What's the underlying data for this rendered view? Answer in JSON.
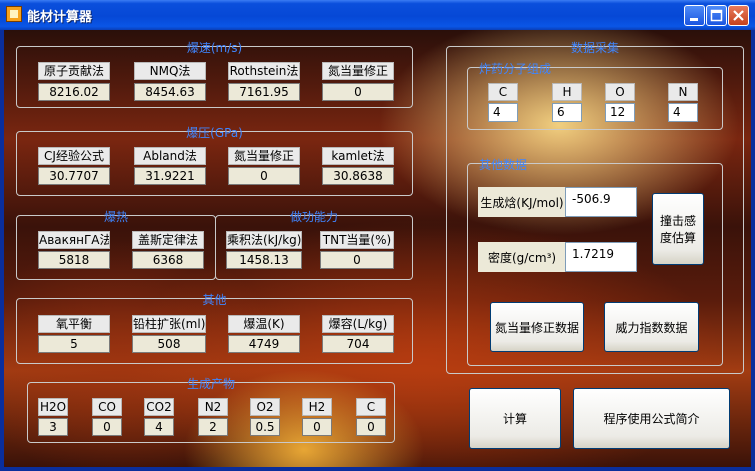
{
  "window": {
    "title": "能材计算器"
  },
  "detonation_velocity": {
    "title": "爆速(m/s)",
    "items": [
      {
        "label": "原子贡献法",
        "value": "8216.02"
      },
      {
        "label": "NMQ法",
        "value": "8454.63"
      },
      {
        "label": "Rothstein法",
        "value": "7161.95"
      },
      {
        "label": "氮当量修正",
        "value": "0"
      }
    ]
  },
  "detonation_pressure": {
    "title": "爆压(GPa)",
    "items": [
      {
        "label": "CJ经验公式",
        "value": "30.7707"
      },
      {
        "label": "Abland法",
        "value": "31.9221"
      },
      {
        "label": "氮当量修正",
        "value": "0"
      },
      {
        "label": "kamlet法",
        "value": "30.8638"
      }
    ]
  },
  "explosion_heat": {
    "title": "爆热",
    "items": [
      {
        "label": "AвакянГА法",
        "value": "5818"
      },
      {
        "label": "盖斯定律法",
        "value": "6368"
      }
    ]
  },
  "work_capacity": {
    "title": "做功能力",
    "items": [
      {
        "label": "乘积法(kJ/kg)",
        "value": "1458.13"
      },
      {
        "label": "TNT当量(%)",
        "value": "0"
      }
    ]
  },
  "other": {
    "title": "其他",
    "items": [
      {
        "label": "氧平衡",
        "value": "5"
      },
      {
        "label": "铅柱扩张(ml)",
        "value": "508"
      },
      {
        "label": "爆温(K)",
        "value": "4749"
      },
      {
        "label": "爆容(L/kg)",
        "value": "704"
      }
    ]
  },
  "products": {
    "title": "生成产物",
    "items": [
      {
        "label": "H2O",
        "value": "3"
      },
      {
        "label": "CO",
        "value": "0"
      },
      {
        "label": "CO2",
        "value": "4"
      },
      {
        "label": "N2",
        "value": "2"
      },
      {
        "label": "O2",
        "value": "0.5"
      },
      {
        "label": "H2",
        "value": "0"
      },
      {
        "label": "C",
        "value": "0"
      }
    ]
  },
  "data_collection": {
    "title": "数据采集",
    "composition": {
      "title": "炸药分子组成",
      "items": [
        {
          "label": "C",
          "value": "4"
        },
        {
          "label": "H",
          "value": "6"
        },
        {
          "label": "O",
          "value": "12"
        },
        {
          "label": "N",
          "value": "4"
        }
      ]
    },
    "other_data": {
      "title": "其他数据",
      "enthalpy_label": "生成焓(KJ/mol)",
      "enthalpy_value": "-506.9",
      "density_label": "密度(g/cm³)",
      "density_value": "1.7219",
      "impact_button": "撞击感度估算",
      "nitrogen_button": "氮当量修正数据",
      "power_button": "威力指数数据"
    }
  },
  "actions": {
    "calculate": "计算",
    "intro": "程序使用公式简介"
  }
}
